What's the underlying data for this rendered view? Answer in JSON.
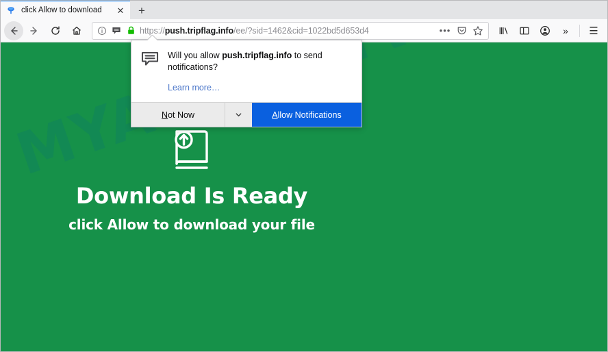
{
  "browser": {
    "tab": {
      "title": "click Allow to download",
      "favicon_name": "blue-pin-favicon",
      "close_label": "✕"
    },
    "new_tab_label": "+",
    "nav": {
      "back_label": "←",
      "forward_label": "→",
      "reload_label": "↻",
      "home_label": "⌂"
    },
    "urlbar": {
      "scheme": "https://",
      "host": "push.tripflag.info",
      "path": "/ee/?sid=1462&cid=1022bd5d653d4",
      "full_url": "https://push.tripflag.info/ee/?sid=1462&cid=1022bd5d653d4",
      "identity_icons": [
        "info-icon",
        "notification-bubble-icon",
        "lock-icon"
      ],
      "action_icons": [
        "page-actions-ellipsis-icon",
        "pocket-save-icon",
        "bookmark-star-icon"
      ],
      "ellipsis_label": "•••"
    },
    "toolbar_right": {
      "library_label": "library-icon",
      "sidebar_label": "sidebar-icon",
      "account_label": "account-icon",
      "overflow_label": "»",
      "menu_label": "☰"
    }
  },
  "permission_dialog": {
    "icon_name": "notification-bubble-icon",
    "question_prefix": "Will you allow ",
    "question_host": "push.tripflag.info",
    "question_suffix": " to send notifications?",
    "learn_more": "Learn more…",
    "not_now_accel": "N",
    "not_now_rest": "ot Now",
    "dropdown_label": "∨",
    "allow_accel": "A",
    "allow_rest": "llow Notifications",
    "allow_button_color": "#0a60df"
  },
  "page": {
    "background_color": "#169149",
    "watermark": "MYANTISPYWARE.COM",
    "icon_name": "book-upload-icon",
    "title": "Download Is Ready",
    "subtitle": "click Allow to download your file"
  }
}
